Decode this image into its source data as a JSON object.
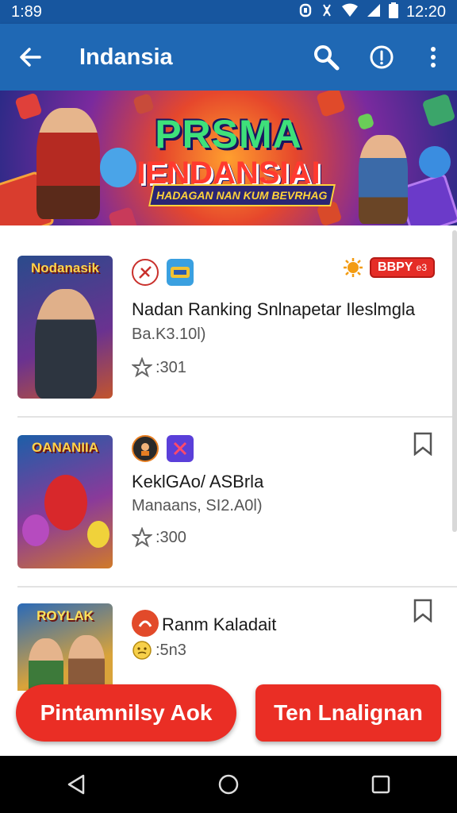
{
  "status_bar": {
    "time": "1:89",
    "clock": "12:20"
  },
  "app_bar": {
    "title": "Indansia"
  },
  "banner": {
    "title_line1": "PRSMA",
    "title_line2": "IENDANSIAI",
    "tagline": "HADAGAN NAN KUM BEVRHAG"
  },
  "items": [
    {
      "thumb_title": "Nodanasik",
      "name": "Nadan Ranking Snlnapetar Ileslmgla",
      "sub": "Ba.K3.10l)",
      "rating": ":301",
      "tag": "BBPY",
      "tag_small": "e3"
    },
    {
      "thumb_title": "OANANIIA",
      "name": "KeklGAo/ ASBrla",
      "sub": "Manaans, SI2.A0l)",
      "rating": ":300"
    },
    {
      "thumb_title": "ROYLAK",
      "name": "Ranm Kaladait",
      "rating": ":5n3"
    }
  ],
  "buttons": {
    "primary": "Pintamnilsy Aok",
    "secondary": "Ten Lnalignan"
  },
  "colors": {
    "app_bar": "#1f68b4",
    "status_bar": "#17569f",
    "accent_red": "#ea2e25"
  }
}
